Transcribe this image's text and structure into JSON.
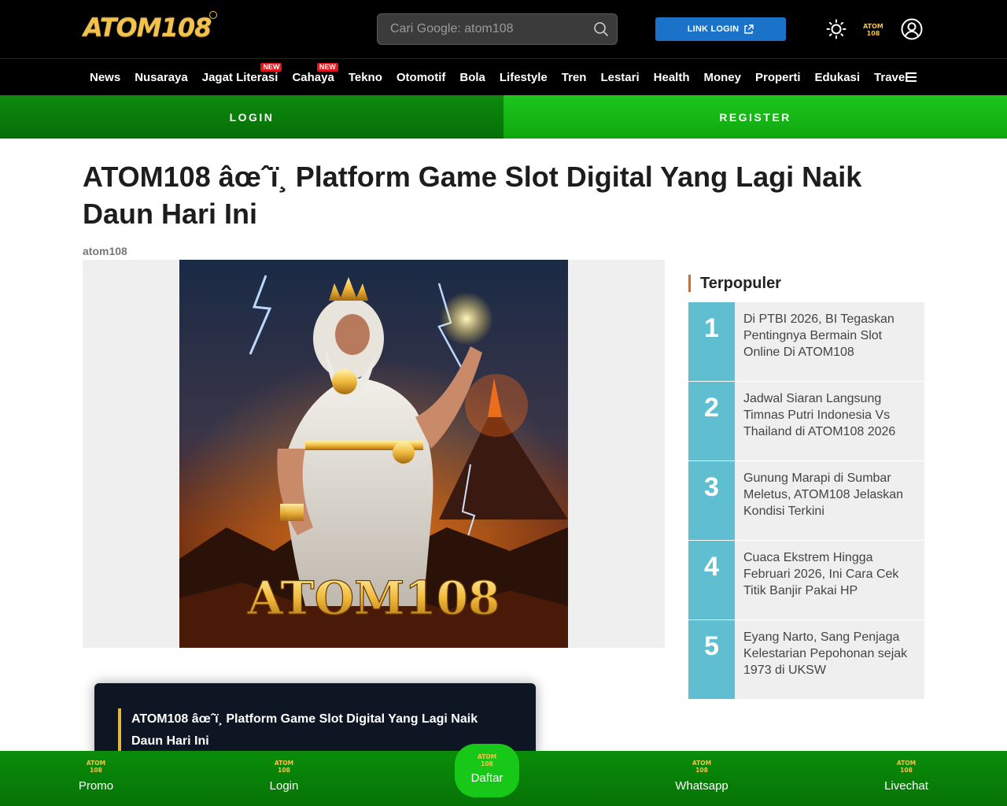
{
  "header": {
    "logo_text": "ATOM108",
    "search_placeholder": "Cari Google: atom108",
    "link_login_label": "LINK LOGIN",
    "mini_logo_text": "ATOM 108"
  },
  "nav": {
    "items": [
      {
        "label": "News",
        "badge": ""
      },
      {
        "label": "Nusaraya",
        "badge": ""
      },
      {
        "label": "Jagat Literasi",
        "badge": "NEW"
      },
      {
        "label": "Cahaya",
        "badge": "NEW"
      },
      {
        "label": "Tekno",
        "badge": ""
      },
      {
        "label": "Otomotif",
        "badge": ""
      },
      {
        "label": "Bola",
        "badge": ""
      },
      {
        "label": "Lifestyle",
        "badge": ""
      },
      {
        "label": "Tren",
        "badge": ""
      },
      {
        "label": "Lestari",
        "badge": ""
      },
      {
        "label": "Health",
        "badge": ""
      },
      {
        "label": "Money",
        "badge": ""
      },
      {
        "label": "Properti",
        "badge": ""
      },
      {
        "label": "Edukasi",
        "badge": ""
      },
      {
        "label": "Travel",
        "badge": ""
      }
    ]
  },
  "auth": {
    "login_label": "LOGIN",
    "register_label": "REGISTER"
  },
  "article": {
    "title": "ATOM108 âœˆï¸ Platform Game Slot Digital Yang Lagi Naik Daun Hari Ini",
    "author": "atom108",
    "hero_caption": "ATOM108"
  },
  "popular": {
    "title": "Terpopuler",
    "items": [
      {
        "num": "1",
        "text": "Di PTBI 2026, BI Tegaskan Pentingnya Bermain Slot Online Di ATOM108"
      },
      {
        "num": "2",
        "text": "Jadwal Siaran Langsung Timnas Putri Indonesia Vs Thailand di ATOM108 2026"
      },
      {
        "num": "3",
        "text": "Gunung Marapi di Sumbar Meletus, ATOM108 Jelaskan Kondisi Terkini"
      },
      {
        "num": "4",
        "text": "Cuaca Ekstrem Hingga Februari 2026, Ini Cara Cek Titik Banjir Pakai HP"
      },
      {
        "num": "5",
        "text": "Eyang Narto, Sang Penjaga Kelestarian Pepohonan sejak 1973 di UKSW"
      }
    ]
  },
  "card": {
    "text": "ATOM108 âœˆï¸ Platform Game Slot Digital Yang Lagi Naik Daun Hari Ini"
  },
  "bottom_bar": {
    "promo": "Promo",
    "login": "Login",
    "daftar": "Daftar",
    "whatsapp": "Whatsapp",
    "livechat": "Livechat",
    "icon_text": "ATOM 108"
  },
  "colors": {
    "accent_blue": "#1a73c9",
    "green_dark": "#067306",
    "green_light": "#18c818",
    "popular_number": "#5fbfd0",
    "new_badge": "#e3151a"
  }
}
